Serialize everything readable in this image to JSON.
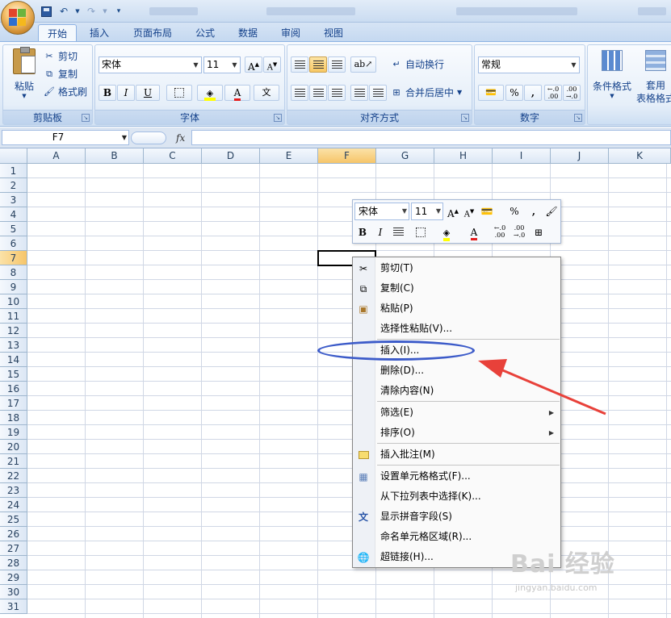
{
  "title_bar": {
    "qat_icons": [
      "save-icon",
      "undo-icon",
      "redo-icon",
      "customize-icon"
    ]
  },
  "ribbon_tabs": [
    "开始",
    "插入",
    "页面布局",
    "公式",
    "数据",
    "审阅",
    "视图"
  ],
  "ribbon": {
    "clipboard": {
      "label": "剪贴板",
      "paste": "粘贴",
      "cut": "剪切",
      "copy": "复制",
      "format_painter": "格式刷"
    },
    "font": {
      "label": "字体",
      "font_name": "宋体",
      "font_size": "11",
      "grow": "A",
      "shrink": "A",
      "bold": "B",
      "italic": "I",
      "underline": "U",
      "font_color": "A"
    },
    "alignment": {
      "label": "对齐方式",
      "wrap": "自动换行",
      "merge": "合并后居中"
    },
    "number": {
      "label": "数字",
      "format": "常规",
      "percent": "%",
      "comma": ",",
      "inc_decimal": "←.0\n.00",
      "dec_decimal": ".00\n→.0"
    },
    "styles": {
      "conditional": "条件格式",
      "table": "套用\n表格格式"
    }
  },
  "formula_bar": {
    "name_box": "F7",
    "fx": "fx"
  },
  "grid": {
    "columns": [
      "A",
      "B",
      "C",
      "D",
      "E",
      "F",
      "G",
      "H",
      "I",
      "J",
      "K"
    ],
    "rows": [
      "1",
      "2",
      "3",
      "4",
      "5",
      "6",
      "7",
      "8",
      "9",
      "10",
      "11",
      "12",
      "13",
      "14",
      "15",
      "16",
      "17",
      "18",
      "19",
      "20",
      "21",
      "22",
      "23",
      "24",
      "25",
      "26",
      "27",
      "28",
      "29",
      "30",
      "31"
    ],
    "selected_column": "F",
    "selected_row": "7"
  },
  "mini_toolbar": {
    "font": "宋体",
    "size": "11",
    "grow": "A",
    "shrink": "A",
    "percent": "%",
    "comma": ",",
    "bold": "B",
    "italic": "I",
    "font_color": "A"
  },
  "context_menu": {
    "items": [
      {
        "label": "剪切(T)",
        "icon": "scissors-icon"
      },
      {
        "label": "复制(C)",
        "icon": "copy-icon"
      },
      {
        "label": "粘贴(P)",
        "icon": "paste-icon"
      },
      {
        "label": "选择性粘贴(V)...",
        "icon": ""
      },
      {
        "label": "插入(I)...",
        "icon": ""
      },
      {
        "label": "删除(D)...",
        "icon": ""
      },
      {
        "label": "清除内容(N)",
        "icon": ""
      },
      {
        "label": "筛选(E)",
        "icon": "",
        "submenu": true
      },
      {
        "label": "排序(O)",
        "icon": "",
        "submenu": true
      },
      {
        "label": "插入批注(M)",
        "icon": "comment-icon"
      },
      {
        "label": "设置单元格格式(F)...",
        "icon": "format-cells-icon"
      },
      {
        "label": "从下拉列表中选择(K)...",
        "icon": ""
      },
      {
        "label": "显示拼音字段(S)",
        "icon": "phonetic-icon"
      },
      {
        "label": "命名单元格区域(R)...",
        "icon": ""
      },
      {
        "label": "超链接(H)...",
        "icon": "hyperlink-icon"
      }
    ]
  },
  "watermark": {
    "main": "Bai 经验",
    "sub": "jingyan.baidu.com"
  },
  "colors": {
    "annotation": "#3c5bc9",
    "arrow": "#e8413a",
    "selection_header": "#f6c569"
  }
}
